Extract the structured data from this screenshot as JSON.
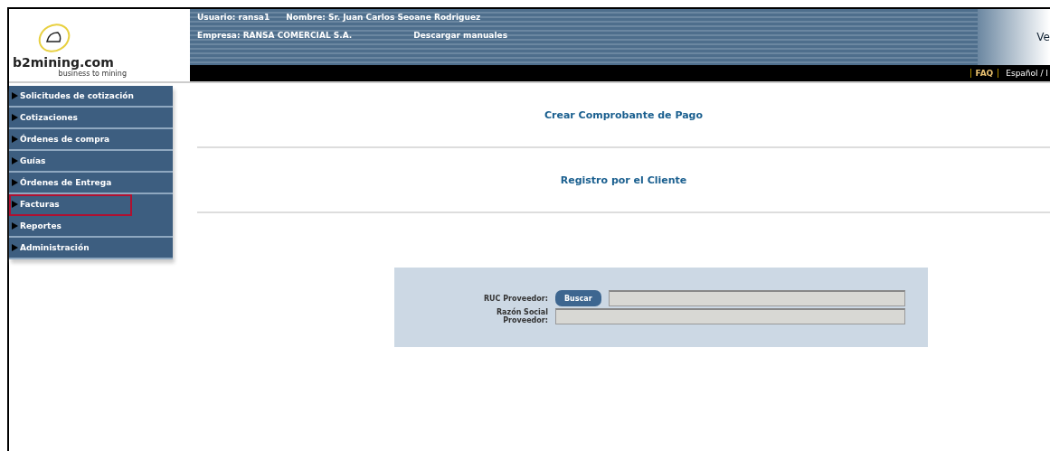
{
  "header": {
    "logo": {
      "name": "b2mining.com",
      "tagline": "business to mining"
    },
    "user_label": "Usuario:",
    "user": "ransa1",
    "name_label": "Nombre:",
    "name": "Sr. Juan Carlos Seoane Rodriguez",
    "company_label": "Empresa:",
    "company": "RANSA COMERCIAL S.A.",
    "download": "Descargar manuales",
    "corner_text": "Ve",
    "links": [
      "FAQ",
      "Español / I"
    ]
  },
  "sidebar": {
    "items": [
      {
        "label": "Solicitudes de cotización",
        "selected": false
      },
      {
        "label": "Cotizaciones",
        "selected": false
      },
      {
        "label": "Órdenes de compra",
        "selected": false
      },
      {
        "label": "Guías",
        "selected": false
      },
      {
        "label": "Órdenes de Entrega",
        "selected": false
      },
      {
        "label": "Facturas",
        "selected": true
      },
      {
        "label": "Reportes",
        "selected": false
      },
      {
        "label": "Administración",
        "selected": false
      }
    ]
  },
  "main": {
    "title": "Crear Comprobante de Pago",
    "subtitle": "Registro por el Cliente",
    "form": {
      "ruc_label": "RUC Proveedor:",
      "search_button": "Buscar",
      "razon_label": "Razón Social Proveedor:"
    }
  }
}
